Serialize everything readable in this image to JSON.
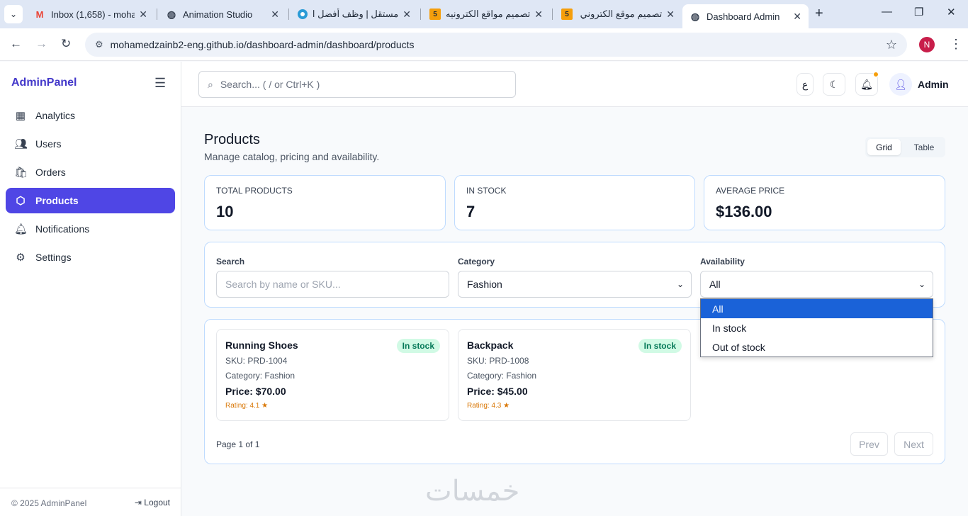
{
  "browser": {
    "tabs": [
      {
        "title": "Inbox (1,658) - moha",
        "favicon": "gmail-icon"
      },
      {
        "title": "Animation Studio",
        "favicon": "globe-icon"
      },
      {
        "title": "مستقل | وظف أفضل ا",
        "favicon": "mostaql-icon"
      },
      {
        "title": "تصميم مواقع الكترونيه",
        "favicon": "khamsat-icon",
        "badge": "5"
      },
      {
        "title": "تصميم موقع الكتروني",
        "favicon": "khamsat-icon",
        "badge": "5"
      },
      {
        "title": "Dashboard Admin",
        "favicon": "globe-icon"
      }
    ],
    "url": "mohamedzainb2-eng.github.io/dashboard-admin/dashboard/products",
    "profile_initial": "N"
  },
  "sidebar": {
    "brand": "AdminPanel",
    "items": [
      {
        "label": "Analytics",
        "icon": "analytics-icon"
      },
      {
        "label": "Users",
        "icon": "users-icon"
      },
      {
        "label": "Orders",
        "icon": "orders-icon"
      },
      {
        "label": "Products",
        "icon": "products-icon"
      },
      {
        "label": "Notifications",
        "icon": "bell-icon"
      },
      {
        "label": "Settings",
        "icon": "gear-icon"
      }
    ],
    "active": "Products",
    "copyright": "© 2025 AdminPanel",
    "logout": "Logout"
  },
  "topbar": {
    "search_placeholder": "Search... ( / or Ctrl+K )",
    "lang_label": "ع",
    "user_name": "Admin"
  },
  "page": {
    "title": "Products",
    "subtitle": "Manage catalog, pricing and availability.",
    "view_grid": "Grid",
    "view_table": "Table",
    "view_selected": "Grid"
  },
  "stats": [
    {
      "label": "TOTAL PRODUCTS",
      "value": "10"
    },
    {
      "label": "IN STOCK",
      "value": "7"
    },
    {
      "label": "AVERAGE PRICE",
      "value": "$136.00"
    }
  ],
  "filters": {
    "search_label": "Search",
    "search_placeholder": "Search by name or SKU...",
    "category_label": "Category",
    "category_value": "Fashion",
    "availability_label": "Availability",
    "availability_value": "All",
    "availability_options": [
      "All",
      "In stock",
      "Out of stock"
    ],
    "availability_highlighted": "All"
  },
  "products": [
    {
      "name": "Running Shoes",
      "badge": "In stock",
      "sku": "SKU: PRD-1004",
      "category": "Category: Fashion",
      "price": "Price: $70.00",
      "rating": "Rating: 4.1 ★"
    },
    {
      "name": "Backpack",
      "badge": "In stock",
      "sku": "SKU: PRD-1008",
      "category": "Category: Fashion",
      "price": "Price: $45.00",
      "rating": "Rating: 4.3 ★"
    }
  ],
  "pagination": {
    "info": "Page 1 of 1",
    "prev": "Prev",
    "next": "Next"
  },
  "watermark": "خمسات"
}
